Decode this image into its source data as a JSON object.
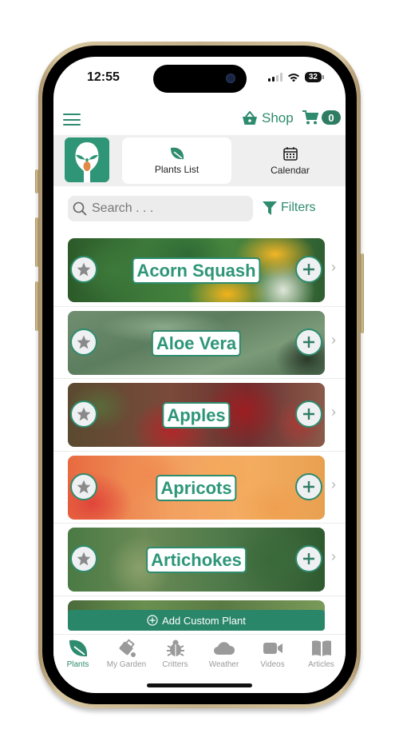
{
  "status_bar": {
    "time": "12:55",
    "battery": "32"
  },
  "header": {
    "shop_label": "Shop",
    "cart_count": "0"
  },
  "top_tabs": [
    {
      "label": "Plants List",
      "icon": "leaf-icon",
      "active": true
    },
    {
      "label": "Calendar",
      "icon": "calendar-icon",
      "active": false
    }
  ],
  "search": {
    "placeholder": "Search . . .",
    "value": ""
  },
  "filters_label": "Filters",
  "plants": [
    {
      "name": "Acorn Squash"
    },
    {
      "name": "Aloe Vera"
    },
    {
      "name": "Apples"
    },
    {
      "name": "Apricots"
    },
    {
      "name": "Artichokes"
    },
    {
      "name": ""
    }
  ],
  "add_custom_label": "Add Custom Plant",
  "bottom_nav": [
    {
      "label": "Plants",
      "icon": "leaf-icon",
      "active": true
    },
    {
      "label": "My Garden",
      "icon": "watering-can-icon",
      "active": false
    },
    {
      "label": "Critters",
      "icon": "bug-icon",
      "active": false
    },
    {
      "label": "Weather",
      "icon": "cloud-icon",
      "active": false
    },
    {
      "label": "Videos",
      "icon": "video-camera-icon",
      "active": false
    },
    {
      "label": "Articles",
      "icon": "book-icon",
      "active": false
    }
  ],
  "colors": {
    "brand": "#2e8b6e",
    "brand_dark": "#2a8669",
    "inactive": "#9a9a9a"
  }
}
